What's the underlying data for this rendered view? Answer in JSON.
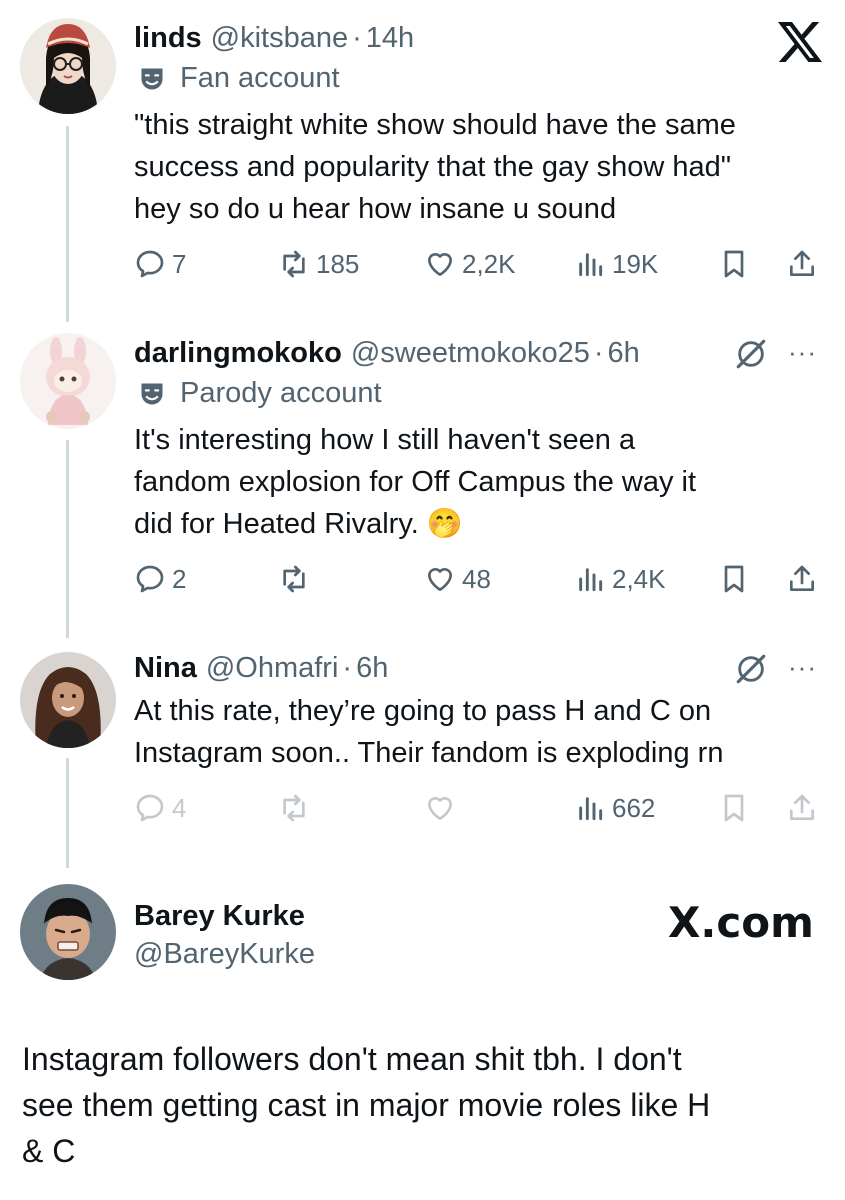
{
  "tweets": [
    {
      "name": "linds",
      "handle": "@kitsbane",
      "time": "14h",
      "label": "Fan account",
      "lines": [
        "\"this straight white show should have the same",
        "success and popularity that the gay show had\"",
        "hey so do u hear how insane u sound"
      ],
      "replies": "7",
      "reposts": "185",
      "likes": "2,2K",
      "views": "19K"
    },
    {
      "name": "darlingmokoko",
      "handle": "@sweetmokoko25",
      "time": "6h",
      "label": "Parody account",
      "lines": [
        "It's interesting how I still haven't seen a",
        "fandom explosion for Off Campus the way it",
        "did for Heated Rivalry."
      ],
      "emoji": "🤭",
      "replies": "2",
      "reposts": "",
      "likes": "48",
      "views": "2,4K"
    },
    {
      "name": "Nina",
      "handle": "@Ohmafri",
      "time": "6h",
      "lines": [
        "At this rate, they’re going to pass H and C on",
        "Instagram soon.. Their fandom is exploding rn"
      ],
      "replies": "4",
      "reposts": "",
      "likes": "",
      "views": "662"
    }
  ],
  "quote": {
    "name": "Barey Kurke",
    "handle": "@BareyKurke",
    "brand": "X.com",
    "lines": [
      "Instagram followers don't mean shit tbh. I don't",
      "see them getting cast in major movie roles like H",
      "& C"
    ]
  },
  "separator": "·",
  "more_glyph": "···",
  "icons": {
    "reply": "reply-icon",
    "repost": "repost-icon",
    "like": "heart-icon",
    "views": "views-icon",
    "bookmark": "bookmark-icon",
    "share": "share-icon",
    "label": "theater-mask-icon",
    "grok": "grok-icon",
    "more": "more-icon",
    "logo": "x-logo-icon"
  },
  "colors": {
    "text": "#0f1419",
    "secondary": "#536471",
    "thread_line": "#cfd9de"
  }
}
